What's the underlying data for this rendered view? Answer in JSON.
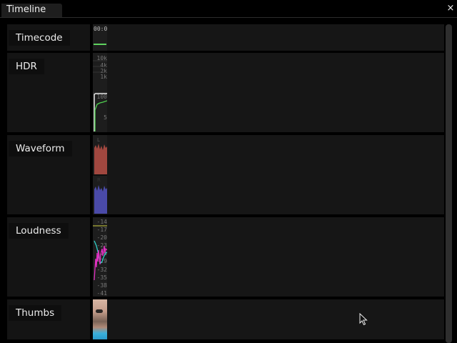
{
  "window": {
    "title": "Timeline",
    "close_glyph": "×"
  },
  "tracks": [
    {
      "label": "Timecode",
      "timecode_text": "00:0"
    },
    {
      "label": "HDR",
      "scale": [
        "10k",
        "4k",
        "2k",
        "1k",
        "100",
        "5"
      ]
    },
    {
      "label": "Waveform",
      "channels": [
        "L",
        "R"
      ]
    },
    {
      "label": "Loudness",
      "scale": [
        "-14",
        "-17",
        "-20",
        "-23",
        "-26",
        "-29",
        "-32",
        "-35",
        "-38",
        "-41"
      ]
    },
    {
      "label": "Thumbs"
    }
  ],
  "colors": {
    "timecode_bar": "#5fd35f",
    "hdr_white": "#e8e8e8",
    "hdr_green": "#4fcf4f",
    "waveform_left": "#a0473f",
    "waveform_right": "#4a4aa8",
    "loudness_momentary": "#e030c0",
    "loudness_shortterm": "#30d0c8",
    "loudness_target": "#d0d040"
  },
  "icons": {
    "close": "close-icon",
    "cursor": "mouse-pointer-icon"
  }
}
